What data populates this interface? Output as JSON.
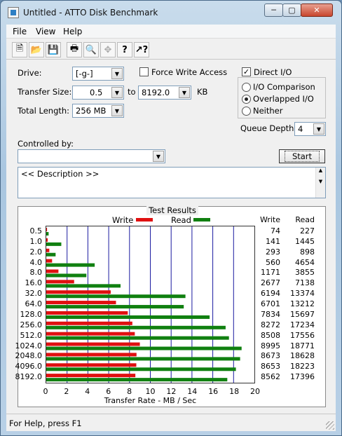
{
  "window": {
    "title": "Untitled - ATTO Disk Benchmark"
  },
  "menu": {
    "items": [
      "File",
      "View",
      "Help"
    ]
  },
  "toolbar": {
    "icons": [
      "new-document-icon",
      "open-folder-icon",
      "save-disk-icon",
      "print-icon",
      "print-preview-icon",
      "move-cross-icon",
      "help-question-icon",
      "context-help-icon"
    ]
  },
  "settings": {
    "drive_label": "Drive:",
    "drive_value": "[-g-]",
    "force_write_label": "Force Write Access",
    "force_write_checked": false,
    "direct_io_label": "Direct I/O",
    "direct_io_checked": true,
    "transfer_size_label": "Transfer Size:",
    "transfer_from": "0.5",
    "transfer_to_label": "to",
    "transfer_to": "8192.0",
    "transfer_unit": "KB",
    "total_length_label": "Total Length:",
    "total_length_value": "256 MB",
    "radio_io_comparison": "I/O Comparison",
    "radio_overlapped": "Overlapped I/O",
    "radio_neither": "Neither",
    "selected_radio": "Overlapped I/O",
    "queue_depth_label": "Queue Depth:",
    "queue_depth_value": "4",
    "controlled_by_label": "Controlled by:",
    "controlled_by_value": "",
    "start_label": "Start",
    "description": "<< Description >>"
  },
  "results": {
    "title": "Test Results",
    "legend_write": "Write",
    "legend_read": "Read",
    "col_write": "Write",
    "col_read": "Read",
    "write_color": "#e01010",
    "read_color": "#108010"
  },
  "chart_data": {
    "type": "bar",
    "orientation": "horizontal",
    "categories": [
      "0.5",
      "1.0",
      "2.0",
      "4.0",
      "8.0",
      "16.0",
      "32.0",
      "64.0",
      "128.0",
      "256.0",
      "512.0",
      "1024.0",
      "2048.0",
      "4096.0",
      "8192.0"
    ],
    "series": [
      {
        "name": "Write",
        "values": [
          74,
          141,
          293,
          560,
          1171,
          2677,
          6194,
          6701,
          7834,
          8272,
          8508,
          8995,
          8673,
          8653,
          8562
        ]
      },
      {
        "name": "Read",
        "values": [
          227,
          1445,
          898,
          4654,
          3855,
          7138,
          13374,
          13212,
          15697,
          17234,
          17556,
          18771,
          18628,
          18223,
          17396
        ]
      }
    ],
    "x_ticks": [
      "0",
      "2",
      "4",
      "6",
      "8",
      "10",
      "12",
      "14",
      "16",
      "18",
      "20"
    ],
    "xlabel": "Transfer Rate - MB / Sec",
    "xlim": [
      0,
      20
    ],
    "value_unit_note": "values in KB/s; axis in MB/s",
    "grid": true,
    "legend": "top"
  },
  "status": {
    "text": "For Help, press F1"
  }
}
